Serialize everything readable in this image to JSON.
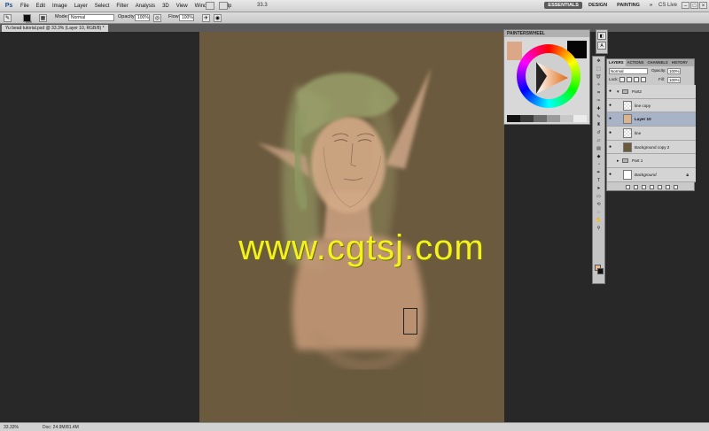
{
  "menubar": {
    "logo": "Ps",
    "items": [
      "File",
      "Edit",
      "Image",
      "Layer",
      "Select",
      "Filter",
      "Analysis",
      "3D",
      "View",
      "Window",
      "Help"
    ],
    "zoom": "33.3",
    "workspaces": [
      "ESSENTIALS",
      "DESIGN",
      "PAINTING",
      "»"
    ],
    "cs_live": "CS Live"
  },
  "options": {
    "brush_size": "224",
    "mode_label": "Mode:",
    "mode_value": "Normal",
    "opacity_label": "Opacity:",
    "opacity_value": "100%",
    "flow_label": "Flow:",
    "flow_value": "100%"
  },
  "document": {
    "tab_title": "Yu bead tutorial.psd @ 33.3% (Layer 10, RGB/8) *"
  },
  "canvas": {
    "watermark": "www.cgtsj.com"
  },
  "status": {
    "zoom": "33.33%",
    "doc": "Doc: 24.9M/81.4M"
  },
  "painters_wheel": {
    "title": "PAINTERSWHEEL",
    "grays": [
      "#111111",
      "#3c3c3c",
      "#6c6c6c",
      "#9a9a9a",
      "#c8c8c8",
      "#ececec"
    ]
  },
  "layers": {
    "tabs": [
      "LAYERS",
      "ACTIONS",
      "CHANNELS",
      "HISTORY"
    ],
    "blend_mode": "Normal",
    "opacity_label": "Opacity:",
    "opacity_value": "100%",
    "lock_label": "Lock:",
    "fill_label": "Fill:",
    "fill_value": "100%",
    "rows": [
      {
        "name": "Part2",
        "kind": "group",
        "visible": true
      },
      {
        "name": "line copy",
        "kind": "layer",
        "visible": true
      },
      {
        "name": "Layer 10",
        "kind": "layer",
        "visible": true,
        "selected": true
      },
      {
        "name": "line",
        "kind": "layer",
        "visible": true
      },
      {
        "name": "Background copy 2",
        "kind": "layer",
        "visible": true
      },
      {
        "name": "Part 1",
        "kind": "group",
        "visible": false
      },
      {
        "name": "Background",
        "kind": "layer",
        "visible": true,
        "locked": true
      }
    ]
  },
  "colors": {
    "foreground": "#e7b68c",
    "background": "#111111",
    "canvas": "#6b5a3e",
    "watermark": "#f4f21e"
  }
}
